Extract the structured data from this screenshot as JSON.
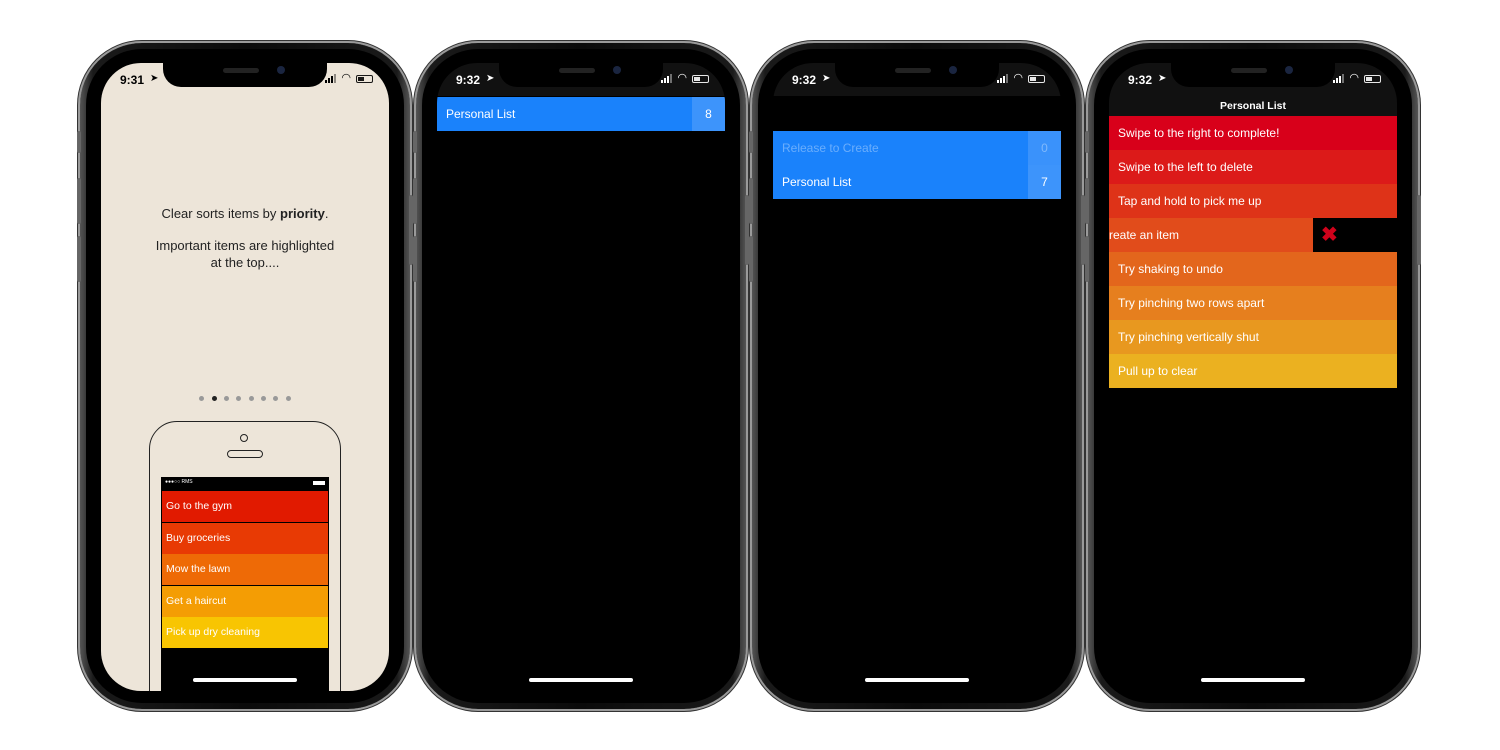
{
  "screens": [
    {
      "time": "9:31",
      "onboarding": {
        "line1_pre": "Clear sorts items by ",
        "line1_bold": "priority",
        "line1_post": ".",
        "line2": "Important items are highlighted",
        "line3": "at the top....",
        "page_index": 2,
        "page_count": 8,
        "mock": {
          "carrier": "●●●○○ RMS",
          "items": [
            "Go to the gym",
            "Buy groceries",
            "Mow the lawn",
            "Get a haircut",
            "Pick up dry cleaning"
          ],
          "colors": [
            "#e11a00",
            "#e83a04",
            "#ee6a06",
            "#f49d04",
            "#f8c502"
          ]
        },
        "background": "#ede5d9"
      }
    },
    {
      "time": "9:32",
      "lists": [
        {
          "name": "Personal List",
          "count": "8"
        }
      ],
      "accent": "#1a82fb"
    },
    {
      "time": "9:32",
      "lists": [
        {
          "name": "Release to Create",
          "count": "0"
        },
        {
          "name": "Personal List",
          "count": "7"
        }
      ]
    },
    {
      "time": "9:32",
      "title": "Personal List",
      "items": [
        "Swipe to the right to complete!",
        "Swipe to the left to delete",
        "Tap and hold to pick me up",
        "reate an item",
        "Try shaking to undo",
        "Try pinching two rows apart",
        "Try pinching vertically shut",
        "Pull up to clear"
      ],
      "colors": [
        "#d8001a",
        "#dc1a19",
        "#de3318",
        "#e14c1b",
        "#e3661c",
        "#e67f1e",
        "#e8981f",
        "#ebb120"
      ],
      "swiped_index": 3,
      "delete_icon": "close-icon",
      "delete_color": "#d0021b"
    }
  ]
}
